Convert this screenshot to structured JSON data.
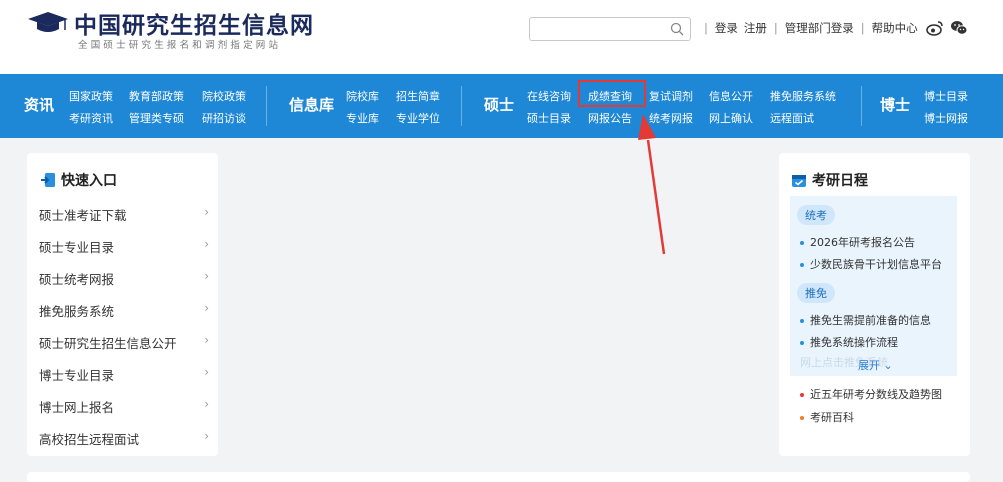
{
  "site": {
    "title": "中国研究生招生信息网",
    "subtitle": "全国硕士研究生报名和调剂指定网站"
  },
  "search": {
    "placeholder": ""
  },
  "toplinks": {
    "login": "登录",
    "register": "注册",
    "admin_login": "管理部门登录",
    "help": "帮助中心"
  },
  "nav": {
    "cat1": "资讯",
    "cat1_links": [
      "国家政策",
      "教育部政策",
      "院校政策",
      "考研资讯",
      "管理类专硕",
      "研招访谈"
    ],
    "cat2": "信息库",
    "cat2_links": [
      "院校库",
      "招生简章",
      "专业库",
      "专业学位"
    ],
    "cat3": "硕士",
    "cat3_links": [
      "在线咨询",
      "成绩查询",
      "复试调剂",
      "信息公开",
      "推免服务系统",
      "硕士目录",
      "网报公告",
      "统考网报",
      "网上确认",
      "远程面试"
    ],
    "cat4": "博士",
    "cat4_links": [
      "博士目录",
      "博士网报"
    ]
  },
  "quick": {
    "title": "快速入口",
    "items": [
      "硕士准考证下载",
      "硕士专业目录",
      "硕士统考网报",
      "推免服务系统",
      "硕士研究生招生信息公开",
      "博士专业目录",
      "博士网上报名",
      "高校招生远程面试"
    ]
  },
  "schedule": {
    "title": "考研日程",
    "tag1": "统考",
    "tag1_items": [
      "2026年研考报名公告",
      "少数民族骨干计划信息平台"
    ],
    "tag2": "推免",
    "tag2_items": [
      "推免生需提前准备的信息",
      "推免系统操作流程"
    ],
    "faded_item": "网上点击推免系统",
    "expand_label": "展开",
    "links": [
      "近五年研考分数线及趋势图",
      "考研百科"
    ]
  },
  "colors": {
    "nav_bg": "#1e87d6",
    "highlight": "#e53935",
    "brand": "#1b2a5c"
  }
}
